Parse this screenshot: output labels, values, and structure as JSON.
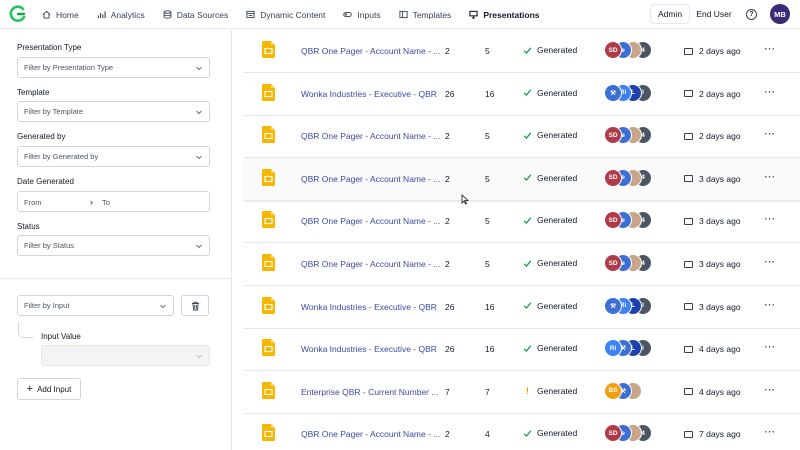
{
  "nav": {
    "items": [
      {
        "label": "Home",
        "icon": "home-icon"
      },
      {
        "label": "Analytics",
        "icon": "bar-chart-icon"
      },
      {
        "label": "Data Sources",
        "icon": "database-icon"
      },
      {
        "label": "Dynamic Content",
        "icon": "content-icon"
      },
      {
        "label": "Inputs",
        "icon": "toggle-icon"
      },
      {
        "label": "Templates",
        "icon": "template-icon"
      },
      {
        "label": "Presentations",
        "icon": "presentation-icon"
      }
    ],
    "admin_label": "Admin",
    "end_user_label": "End User",
    "help_label": "?",
    "user_initials": "MB"
  },
  "filters": {
    "presentation_type": {
      "label": "Presentation Type",
      "placeholder": "Filter by Presentation Type"
    },
    "template": {
      "label": "Template",
      "placeholder": "Filter by Template"
    },
    "generated_by": {
      "label": "Generated by",
      "placeholder": "Filter by Generated by"
    },
    "date_generated": {
      "label": "Date Generated",
      "from": "From",
      "to": "To"
    },
    "status": {
      "label": "Status",
      "placeholder": "Filter by Status"
    },
    "input": {
      "placeholder": "Filter by Input",
      "value_label": "Input Value",
      "add_label": "Add Input"
    }
  },
  "colors": {
    "link": "#3b4aa0",
    "doc_icon": "#f5b700",
    "success": "#16a34a",
    "warning": "#f59e0b"
  },
  "rows": [
    {
      "name": "QBR One Pager - Account Name - ...",
      "c1": "2",
      "c2": "5",
      "status": "Generated",
      "status_icon": "check",
      "avatars": [
        {
          "t": "SD",
          "c": "#b03a48"
        },
        {
          "t": "e",
          "c": "#3b6fd6"
        },
        {
          "t": "",
          "c": "#c9a58a"
        },
        {
          "t": "4",
          "c": "#4b5563"
        }
      ],
      "date": "2 days ago"
    },
    {
      "name": "Wonka Industries - Executive - QBR",
      "c1": "26",
      "c2": "16",
      "status": "Generated",
      "status_icon": "check",
      "avatars": [
        {
          "t": "⚒",
          "c": "#3b6fd6"
        },
        {
          "t": "Ri",
          "c": "#3b82f6"
        },
        {
          "t": "L",
          "c": "#1e40af"
        },
        {
          "t": "I",
          "c": "#4b5563"
        }
      ],
      "date": "2 days ago"
    },
    {
      "name": "QBR One Pager - Account Name - ...",
      "c1": "2",
      "c2": "5",
      "status": "Generated",
      "status_icon": "check",
      "avatars": [
        {
          "t": "SD",
          "c": "#b03a48"
        },
        {
          "t": "e",
          "c": "#3b6fd6"
        },
        {
          "t": "",
          "c": "#c9a58a"
        },
        {
          "t": "4",
          "c": "#4b5563"
        }
      ],
      "date": "2 days ago"
    },
    {
      "name": "QBR One Pager - Account Name - ...",
      "c1": "2",
      "c2": "5",
      "status": "Generated",
      "status_icon": "check",
      "avatars": [
        {
          "t": "SD",
          "c": "#b03a48"
        },
        {
          "t": "e",
          "c": "#3b6fd6"
        },
        {
          "t": "",
          "c": "#c9a58a"
        },
        {
          "t": "4",
          "c": "#4b5563"
        }
      ],
      "date": "3 days ago"
    },
    {
      "name": "QBR One Pager - Account Name - ...",
      "c1": "2",
      "c2": "5",
      "status": "Generated",
      "status_icon": "check",
      "avatars": [
        {
          "t": "SD",
          "c": "#b03a48"
        },
        {
          "t": "e",
          "c": "#3b6fd6"
        },
        {
          "t": "",
          "c": "#c9a58a"
        },
        {
          "t": "4",
          "c": "#4b5563"
        }
      ],
      "date": "3 days ago"
    },
    {
      "name": "QBR One Pager - Account Name - ...",
      "c1": "2",
      "c2": "5",
      "status": "Generated",
      "status_icon": "check",
      "avatars": [
        {
          "t": "SD",
          "c": "#b03a48"
        },
        {
          "t": "e",
          "c": "#3b6fd6"
        },
        {
          "t": "",
          "c": "#c9a58a"
        },
        {
          "t": "4",
          "c": "#4b5563"
        }
      ],
      "date": "3 days ago"
    },
    {
      "name": "Wonka Industries - Executive - QBR",
      "c1": "26",
      "c2": "16",
      "status": "Generated",
      "status_icon": "check",
      "avatars": [
        {
          "t": "⚒",
          "c": "#3b6fd6"
        },
        {
          "t": "Ri",
          "c": "#3b82f6"
        },
        {
          "t": "L",
          "c": "#1e40af"
        },
        {
          "t": "I",
          "c": "#4b5563"
        }
      ],
      "date": "3 days ago"
    },
    {
      "name": "Wonka Industries - Executive - QBR",
      "c1": "26",
      "c2": "16",
      "status": "Generated",
      "status_icon": "check",
      "avatars": [
        {
          "t": "Ri",
          "c": "#3b82f6"
        },
        {
          "t": "⚒",
          "c": "#3b6fd6"
        },
        {
          "t": "L",
          "c": "#1e40af"
        },
        {
          "t": "I",
          "c": "#4b5563"
        }
      ],
      "date": "4 days ago"
    },
    {
      "name": "Enterprise QBR - Current Number ...",
      "c1": "7",
      "c2": "7",
      "status": "Generated",
      "status_icon": "warning",
      "avatars": [
        {
          "t": "BS",
          "c": "#f59e0b"
        },
        {
          "t": "⚒",
          "c": "#3b6fd6"
        },
        {
          "t": "",
          "c": "#c9a58a"
        }
      ],
      "date": "4 days ago"
    },
    {
      "name": "QBR One Pager - Account Name - ...",
      "c1": "2",
      "c2": "4",
      "status": "Generated",
      "status_icon": "check",
      "avatars": [
        {
          "t": "SD",
          "c": "#b03a48"
        },
        {
          "t": "e",
          "c": "#3b6fd6"
        },
        {
          "t": "",
          "c": "#c9a58a"
        },
        {
          "t": "4",
          "c": "#4b5563"
        }
      ],
      "date": "7 days ago"
    }
  ]
}
